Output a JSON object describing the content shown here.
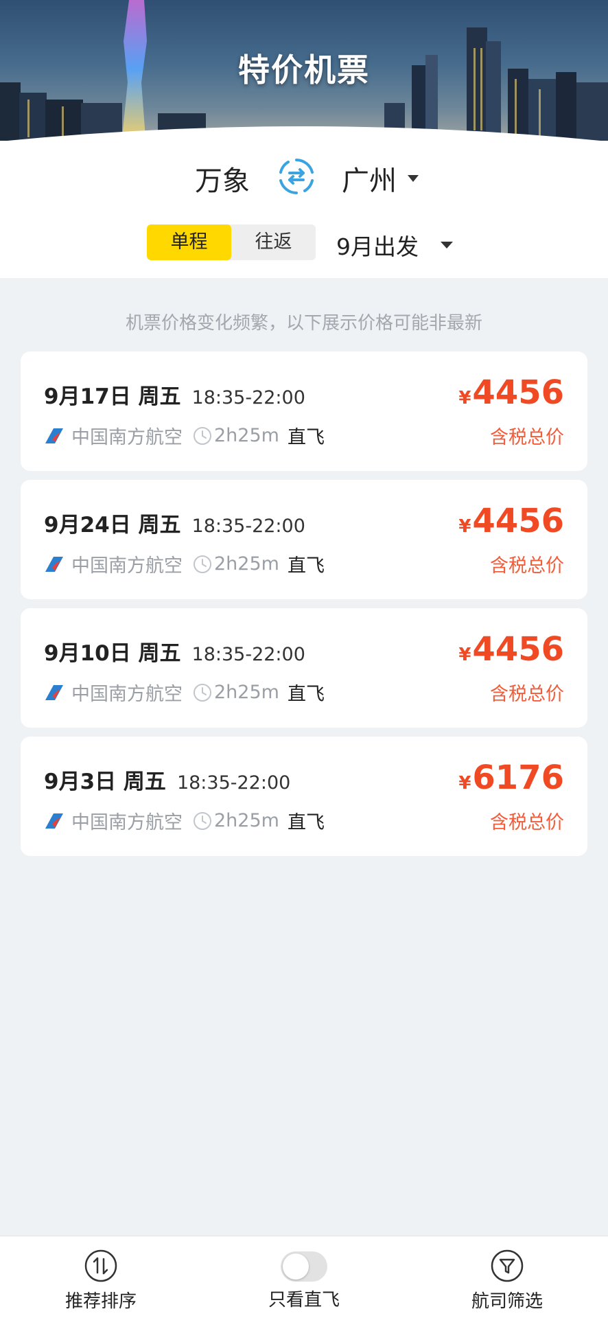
{
  "header": {
    "title": "特价机票"
  },
  "route": {
    "from": "万象",
    "to": "广州"
  },
  "trip_type": {
    "options": [
      "单程",
      "往返"
    ],
    "selected": "单程"
  },
  "departure": {
    "label": "9月出发"
  },
  "notice": "机票价格变化频繁，以下展示价格可能非最新",
  "flights": [
    {
      "date": "9月17日 周五",
      "time": "18:35-22:00",
      "airline": "中国南方航空",
      "duration": "2h25m",
      "type": "直飞",
      "currency": "¥",
      "price": "4456",
      "price_note": "含税总价"
    },
    {
      "date": "9月24日 周五",
      "time": "18:35-22:00",
      "airline": "中国南方航空",
      "duration": "2h25m",
      "type": "直飞",
      "currency": "¥",
      "price": "4456",
      "price_note": "含税总价"
    },
    {
      "date": "9月10日 周五",
      "time": "18:35-22:00",
      "airline": "中国南方航空",
      "duration": "2h25m",
      "type": "直飞",
      "currency": "¥",
      "price": "4456",
      "price_note": "含税总价"
    },
    {
      "date": "9月3日 周五",
      "time": "18:35-22:00",
      "airline": "中国南方航空",
      "duration": "2h25m",
      "type": "直飞",
      "currency": "¥",
      "price": "6176",
      "price_note": "含税总价"
    }
  ],
  "bottom_bar": {
    "sort_label": "推荐排序",
    "direct_only_label": "只看直飞",
    "direct_only_on": false,
    "filter_label": "航司筛选"
  },
  "colors": {
    "accent_yellow": "#ffd800",
    "price_red": "#f04a24",
    "swap_blue": "#3ba4e0",
    "background": "#eff2f5"
  },
  "icons": {
    "swap": "swap-arrows-icon",
    "airline": "china-southern-logo-icon",
    "clock": "clock-icon",
    "sort": "sort-arrows-icon",
    "filter": "funnel-icon"
  }
}
